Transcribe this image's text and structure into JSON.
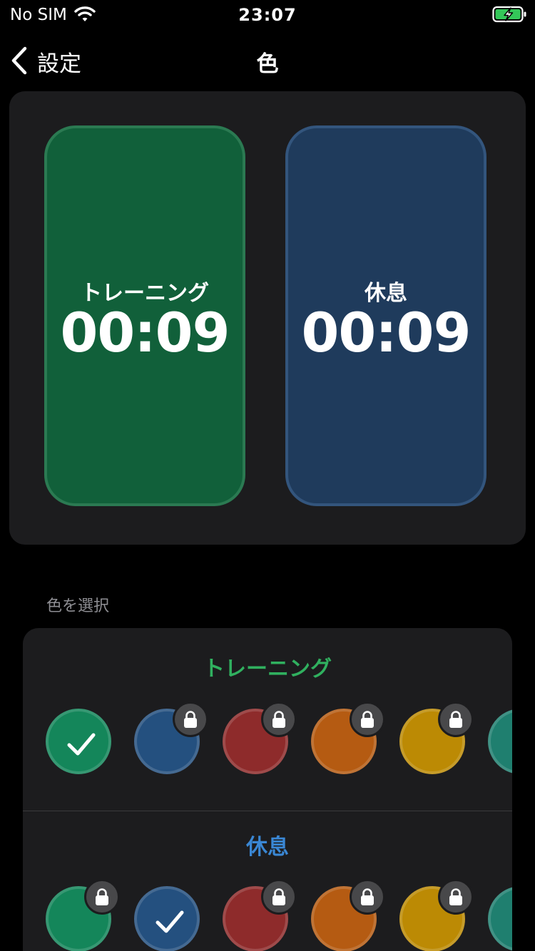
{
  "status_bar": {
    "carrier": "No SIM",
    "time": "23:07"
  },
  "nav": {
    "back_label": "設定",
    "title": "色"
  },
  "preview": {
    "training": {
      "label": "トレーニング",
      "time": "00:09",
      "color": "#11603a"
    },
    "rest": {
      "label": "休息",
      "time": "00:09",
      "color": "#1f3b5c"
    }
  },
  "section_header": "色を選択",
  "picker": {
    "training": {
      "title": "トレーニング",
      "selected": "green",
      "swatches": [
        {
          "name": "green",
          "color": "#14865a",
          "locked": false
        },
        {
          "name": "blue",
          "color": "#24507f",
          "locked": true
        },
        {
          "name": "red",
          "color": "#8e2b2b",
          "locked": true
        },
        {
          "name": "orange",
          "color": "#b55b12",
          "locked": true
        },
        {
          "name": "yellow",
          "color": "#bc8a04",
          "locked": true
        },
        {
          "name": "teal",
          "color": "#1f7f6f",
          "locked": false
        }
      ]
    },
    "rest": {
      "title": "休息",
      "selected": "blue",
      "swatches": [
        {
          "name": "green",
          "color": "#14865a",
          "locked": true
        },
        {
          "name": "blue",
          "color": "#24507f",
          "locked": false
        },
        {
          "name": "red",
          "color": "#8e2b2b",
          "locked": true
        },
        {
          "name": "orange",
          "color": "#b55b12",
          "locked": true
        },
        {
          "name": "yellow",
          "color": "#bc8a04",
          "locked": true
        },
        {
          "name": "teal",
          "color": "#1f7f6f",
          "locked": false
        }
      ]
    }
  }
}
